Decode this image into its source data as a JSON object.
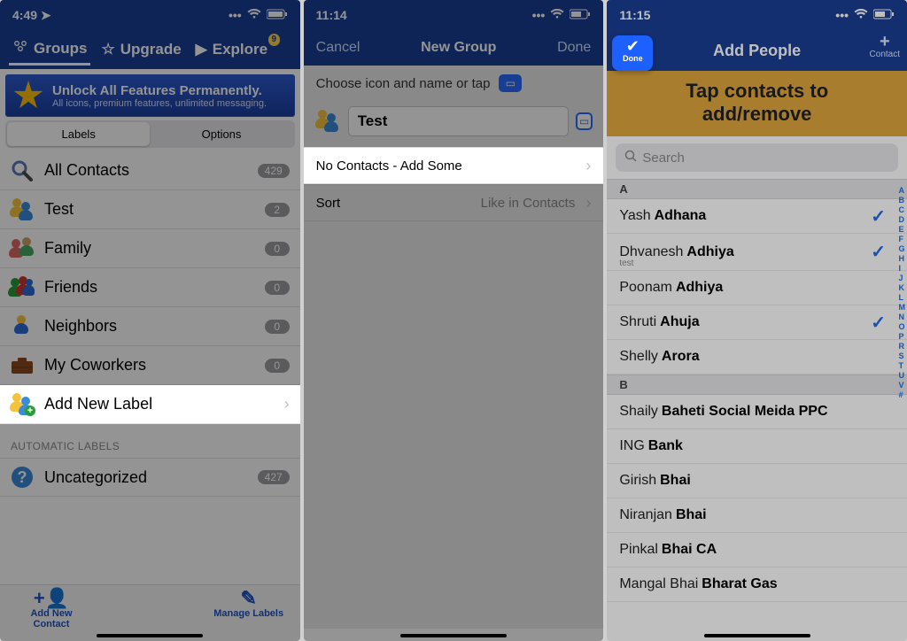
{
  "screen1": {
    "status_time": "4:49",
    "tabs": {
      "groups": "Groups",
      "upgrade": "Upgrade",
      "explore": "Explore",
      "explore_badge": "9"
    },
    "promo_title": "Unlock All Features Permanently.",
    "promo_sub": "All icons, premium features, unlimited messaging.",
    "seg_labels": "Labels",
    "seg_options": "Options",
    "labels": [
      {
        "name": "All Contacts",
        "count": "429"
      },
      {
        "name": "Test",
        "count": "2"
      },
      {
        "name": "Family",
        "count": "0"
      },
      {
        "name": "Friends",
        "count": "0"
      },
      {
        "name": "Neighbors",
        "count": "0"
      },
      {
        "name": "My Coworkers",
        "count": "0"
      }
    ],
    "add_new_label": "Add New Label",
    "auto_section": "AUTOMATIC LABELS",
    "uncategorized": "Uncategorized",
    "uncategorized_count": "427",
    "footer_add": "Add New Contact",
    "footer_manage": "Manage Labels"
  },
  "screen2": {
    "status_time": "11:14",
    "nav_cancel": "Cancel",
    "nav_title": "New Group",
    "nav_done": "Done",
    "choose_text": "Choose icon and name or tap",
    "group_name": "Test",
    "no_contacts": "No Contacts - Add Some",
    "sort_label": "Sort",
    "sort_value": "Like in Contacts"
  },
  "screen3": {
    "status_time": "11:15",
    "title": "Add People",
    "contact_btn": "Contact",
    "done_label": "Done",
    "banner_l1": "Tap contacts to",
    "banner_l2": "add/remove",
    "search_placeholder": "Search",
    "index_letters": [
      "A",
      "B",
      "C",
      "D",
      "E",
      "F",
      "G",
      "H",
      "I",
      "J",
      "K",
      "L",
      "M",
      "N",
      "O",
      "P",
      "R",
      "S",
      "T",
      "U",
      "V",
      "#"
    ],
    "sections": [
      {
        "letter": "A",
        "contacts": [
          {
            "first": "Yash",
            "last": "Adhana",
            "checked": true
          },
          {
            "first": "Dhvanesh",
            "last": "Adhiya",
            "sub": "test",
            "checked": true
          },
          {
            "first": "Poonam",
            "last": "Adhiya"
          },
          {
            "first": "Shruti",
            "last": "Ahuja",
            "checked": true
          },
          {
            "first": "Shelly",
            "last": "Arora"
          }
        ]
      },
      {
        "letter": "B",
        "contacts": [
          {
            "first": "Shaily",
            "last": "Baheti Social Meida PPC"
          },
          {
            "first": "ING",
            "last": "Bank"
          },
          {
            "first": "Girish",
            "last": "Bhai"
          },
          {
            "first": "Niranjan",
            "last": "Bhai"
          },
          {
            "first": "Pinkal",
            "last": "Bhai CA"
          },
          {
            "first": "Mangal Bhai",
            "last": "Bharat Gas"
          }
        ]
      }
    ]
  }
}
